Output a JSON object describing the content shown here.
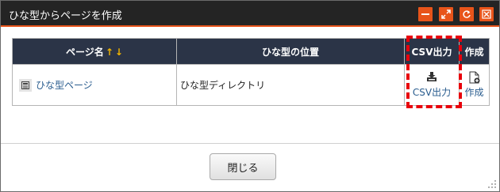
{
  "dialog": {
    "title": "ひな型からページを作成",
    "controls": [
      "minimize-icon",
      "maximize-icon",
      "refresh-icon",
      "close-icon"
    ],
    "accent_color": "#e8541a",
    "header_bg": "#2b3447"
  },
  "table": {
    "headers": {
      "page_name": "ページ名",
      "sort_up": "↑",
      "sort_down": "↓",
      "location": "ひな型の位置",
      "csv": "CSV出力",
      "create": "作成"
    },
    "rows": [
      {
        "page_name": "ひな型ページ",
        "location": "ひな型ディレクトリ",
        "csv_label": "CSV出力",
        "create_label": "作成"
      }
    ]
  },
  "footer": {
    "close_label": "閉じる"
  }
}
